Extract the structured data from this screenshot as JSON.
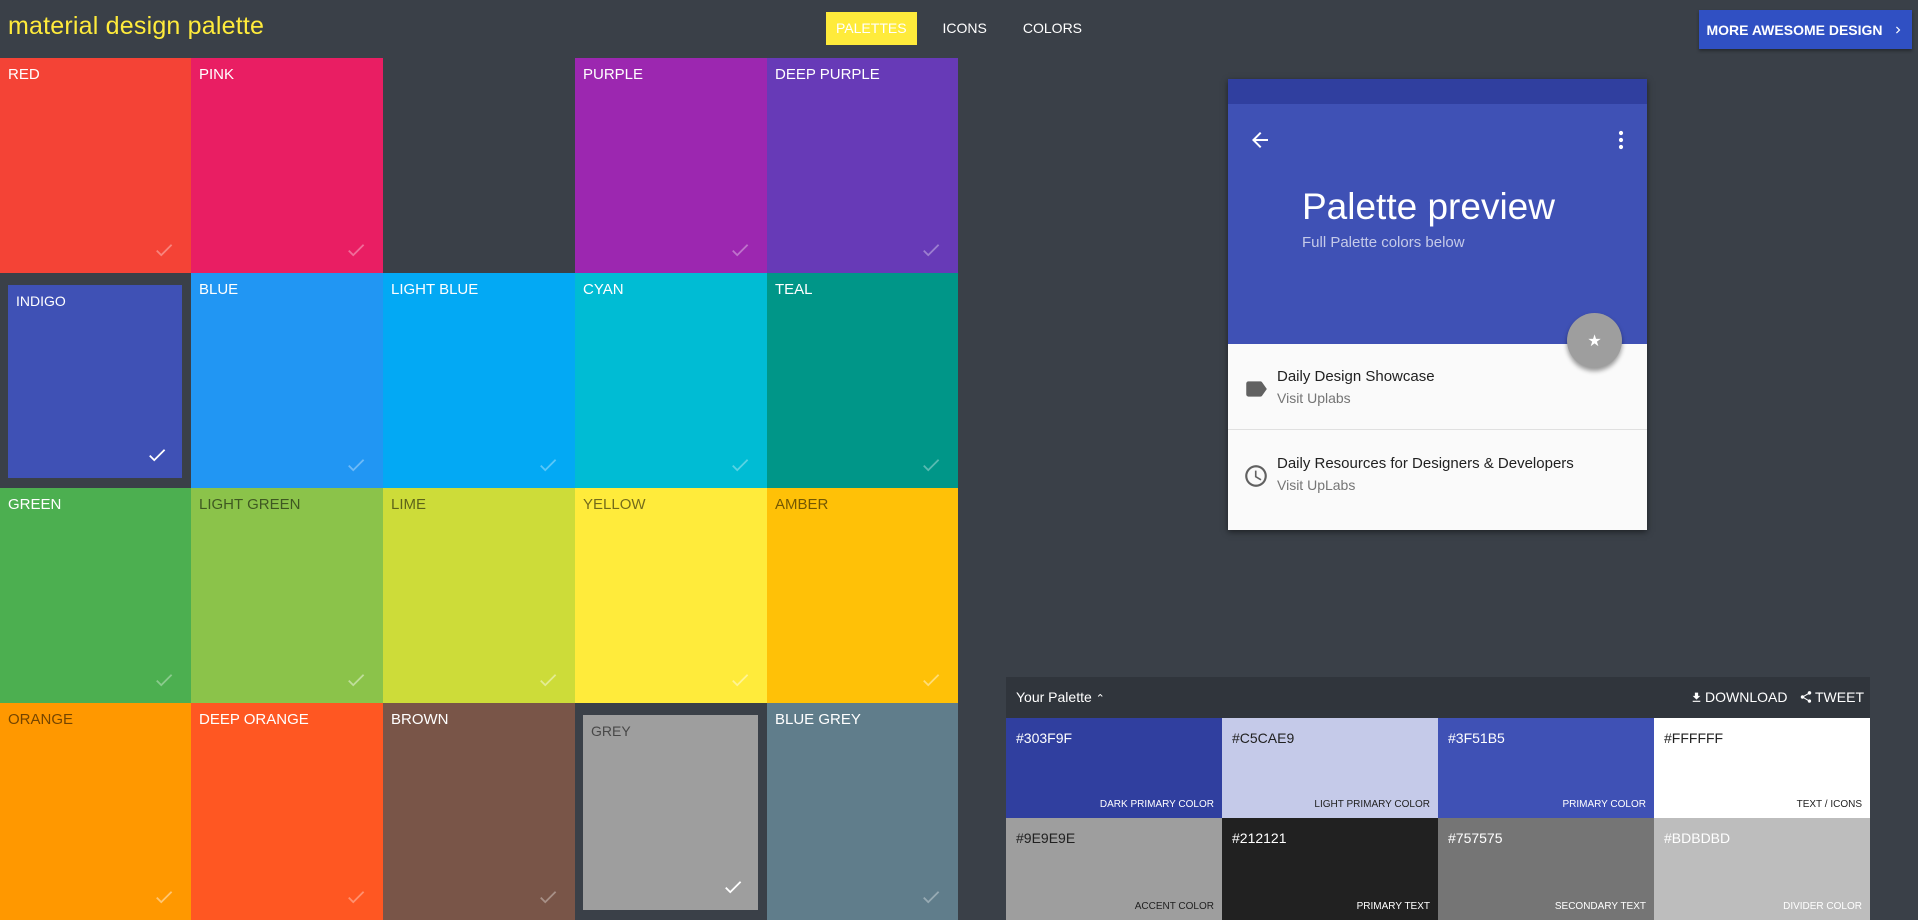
{
  "header": {
    "brand": "material design palette",
    "nav": [
      {
        "label": "PALETTES",
        "active": true
      },
      {
        "label": "ICONS",
        "active": false
      },
      {
        "label": "COLORS",
        "active": false
      }
    ],
    "more_button": "MORE AWESOME DESIGN",
    "accent": "#ffeb3b",
    "button_color": "#3050c3"
  },
  "palette_grid": [
    {
      "label": "RED",
      "color": "#f44336",
      "dark_text": false,
      "selected": false
    },
    {
      "label": "PINK",
      "color": "#e91e63",
      "dark_text": false,
      "selected": false
    },
    {
      "label": "",
      "color": "#3a4048",
      "dark_text": false,
      "selected": false,
      "empty": true
    },
    {
      "label": "PURPLE",
      "color": "#9c27b0",
      "dark_text": false,
      "selected": false
    },
    {
      "label": "DEEP PURPLE",
      "color": "#673ab7",
      "dark_text": false,
      "selected": false
    },
    {
      "label": "INDIGO",
      "color": "#3f51b5",
      "dark_text": false,
      "selected": true
    },
    {
      "label": "BLUE",
      "color": "#2196f3",
      "dark_text": false,
      "selected": false
    },
    {
      "label": "LIGHT BLUE",
      "color": "#03a9f4",
      "dark_text": false,
      "selected": false
    },
    {
      "label": "CYAN",
      "color": "#00bcd4",
      "dark_text": false,
      "selected": false
    },
    {
      "label": "TEAL",
      "color": "#009688",
      "dark_text": false,
      "selected": false
    },
    {
      "label": "GREEN",
      "color": "#4caf50",
      "dark_text": false,
      "selected": false
    },
    {
      "label": "LIGHT GREEN",
      "color": "#8bc34a",
      "dark_text": true,
      "selected": false
    },
    {
      "label": "LIME",
      "color": "#cddc39",
      "dark_text": true,
      "selected": false
    },
    {
      "label": "YELLOW",
      "color": "#ffeb3b",
      "dark_text": true,
      "selected": false
    },
    {
      "label": "AMBER",
      "color": "#ffc107",
      "dark_text": true,
      "selected": false
    },
    {
      "label": "ORANGE",
      "color": "#ff9800",
      "dark_text": true,
      "selected": false
    },
    {
      "label": "DEEP ORANGE",
      "color": "#ff5722",
      "dark_text": false,
      "selected": false
    },
    {
      "label": "BROWN",
      "color": "#795548",
      "dark_text": false,
      "selected": false
    },
    {
      "label": "GREY",
      "color": "#9e9e9e",
      "dark_text": true,
      "selected": true
    },
    {
      "label": "BLUE GREY",
      "color": "#607d8b",
      "dark_text": false,
      "selected": false
    }
  ],
  "preview": {
    "title": "Palette preview",
    "subtitle": "Full Palette colors below",
    "fab_icon": "star-icon",
    "items": [
      {
        "title": "Daily Design Showcase",
        "subtitle": "Visit Uplabs",
        "icon": "label-icon"
      },
      {
        "title": "Daily Resources for Designers & Developers",
        "subtitle": "Visit UpLabs",
        "icon": "clock-icon"
      }
    ]
  },
  "your_palette": {
    "title": "Your Palette",
    "download_label": "DOWNLOAD",
    "tweet_label": "TWEET",
    "swatches": [
      {
        "hex": "#303F9F",
        "role": "DARK PRIMARY COLOR",
        "bg": "#303f9f",
        "fg": "#ffffff"
      },
      {
        "hex": "#C5CAE9",
        "role": "LIGHT PRIMARY COLOR",
        "bg": "#c5cae9",
        "fg": "#212121"
      },
      {
        "hex": "#3F51B5",
        "role": "PRIMARY COLOR",
        "bg": "#3f51b5",
        "fg": "#ffffff"
      },
      {
        "hex": "#FFFFFF",
        "role": "TEXT / ICONS",
        "bg": "#ffffff",
        "fg": "#212121"
      },
      {
        "hex": "#9E9E9E",
        "role": "ACCENT COLOR",
        "bg": "#9e9e9e",
        "fg": "#212121"
      },
      {
        "hex": "#212121",
        "role": "PRIMARY TEXT",
        "bg": "#212121",
        "fg": "#ffffff"
      },
      {
        "hex": "#757575",
        "role": "SECONDARY TEXT",
        "bg": "#757575",
        "fg": "#ffffff"
      },
      {
        "hex": "#BDBDBD",
        "role": "DIVIDER COLOR",
        "bg": "#bdbdbd",
        "fg": "#ffffff"
      }
    ]
  }
}
